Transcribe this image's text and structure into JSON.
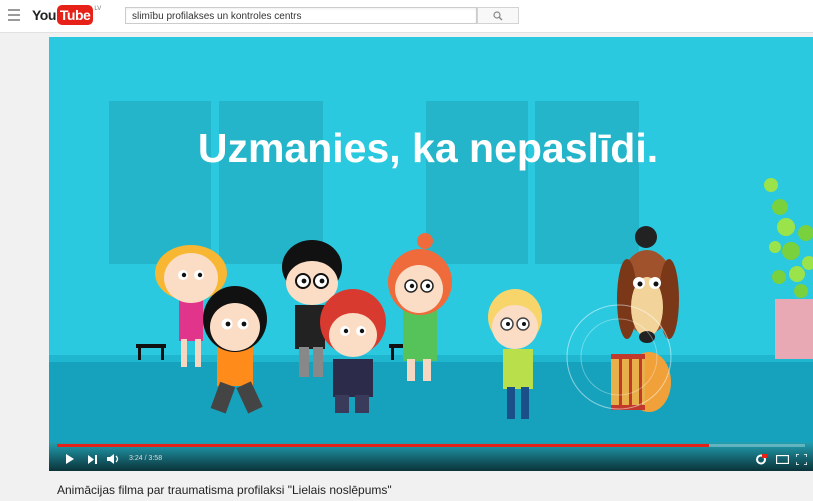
{
  "header": {
    "logo_you": "You",
    "logo_tube": "Tube",
    "logo_country": "LV",
    "search_value": "slimību profilakses un kontroles centrs"
  },
  "video": {
    "overlay_text": "Uzmanies, ka nepaslīdi.",
    "time_display": "3:24 / 3:58",
    "progress": 0.872,
    "title": "Animācijas filma par traumatisma profilaksi \"Lielais noslēpums\""
  },
  "colors": {
    "background": "#2ac9e0",
    "accent": "#e62117"
  },
  "icons": [
    "hamburger-icon",
    "search-icon",
    "play-icon",
    "next-icon",
    "volume-icon",
    "settings-icon",
    "theater-mode-icon",
    "fullscreen-icon"
  ]
}
